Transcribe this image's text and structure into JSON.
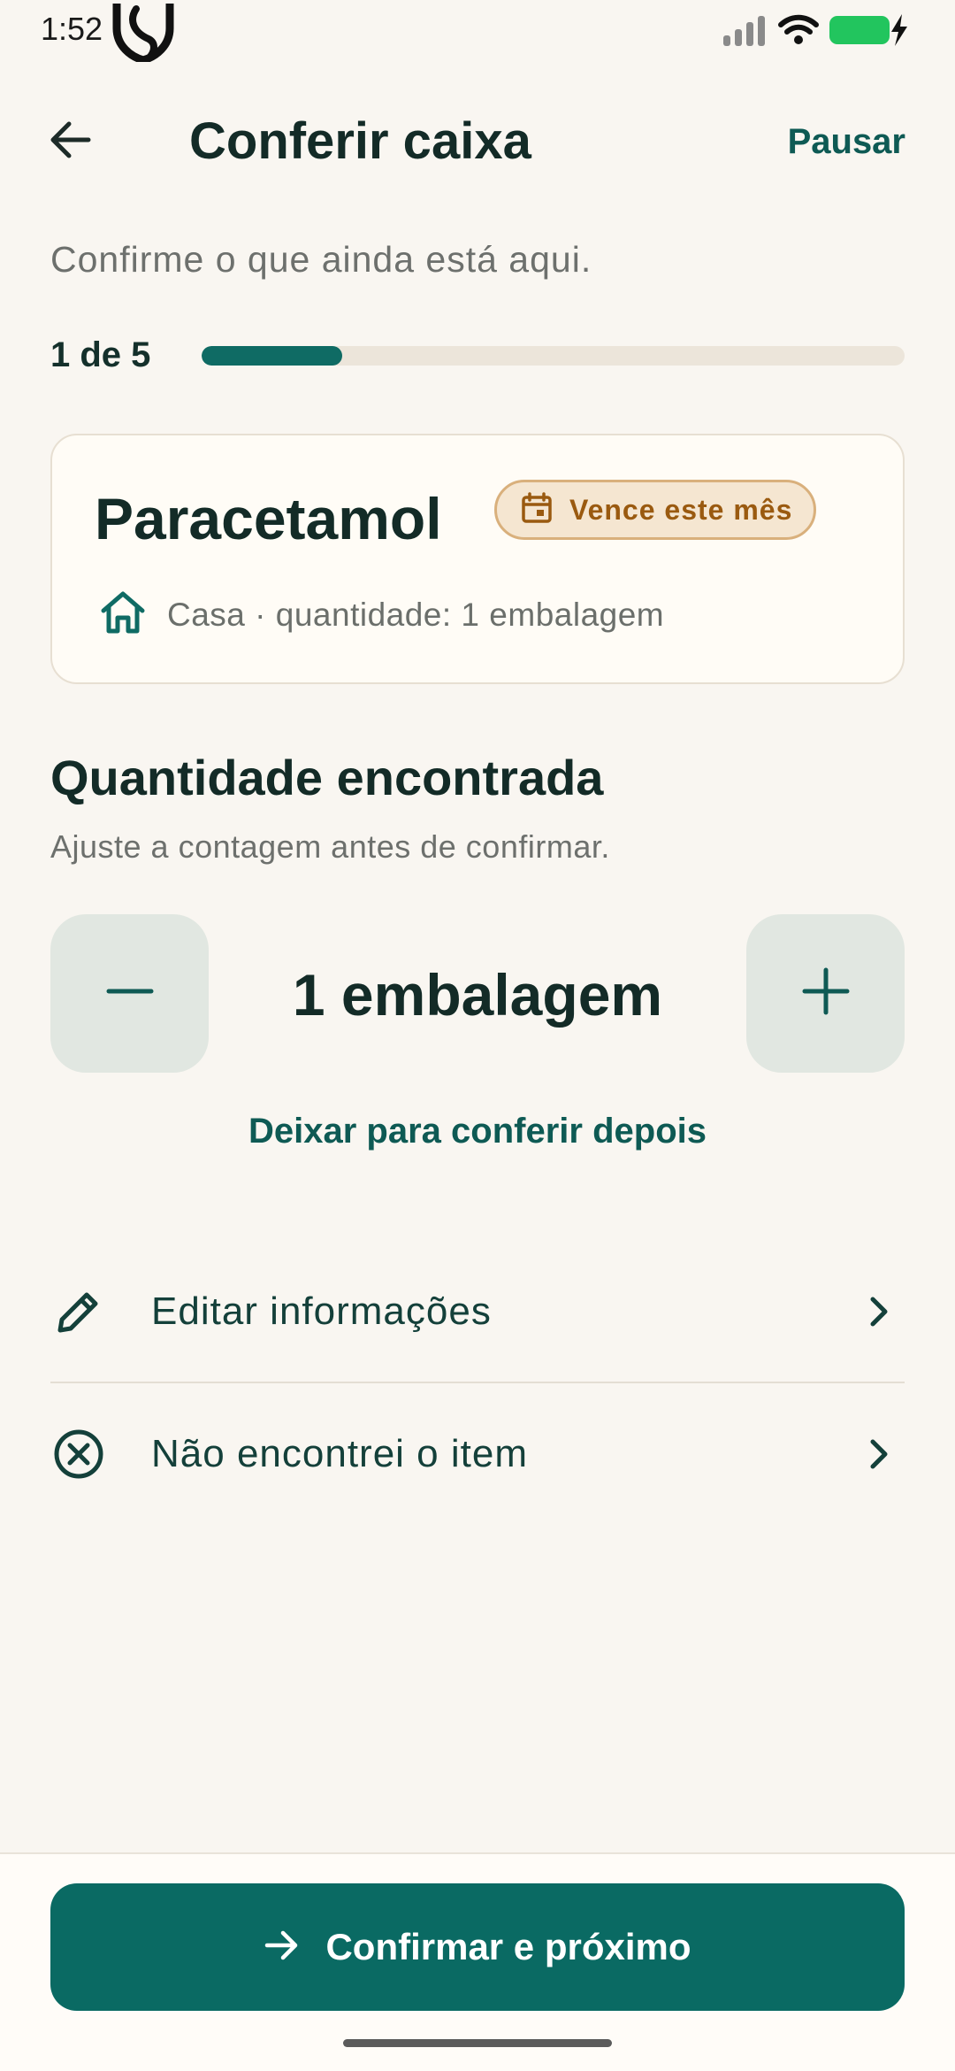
{
  "status_bar": {
    "time": "1:52",
    "icons": [
      "shield-logo-icon",
      "signal-icon",
      "wifi-icon",
      "battery-charging-icon"
    ],
    "battery_color": "#22c55e"
  },
  "header": {
    "back_icon": "arrow-left-icon",
    "title": "Conferir caixa",
    "pause_label": "Pausar"
  },
  "subtitle": "Confirme o que ainda está aqui.",
  "progress": {
    "label": "1 de 5",
    "current": 1,
    "total": 5,
    "fraction": 0.2,
    "fill_color": "#0f6b64"
  },
  "item": {
    "name": "Paracetamol",
    "badge_icon": "calendar-icon",
    "badge_label": "Vence este mês",
    "location_icon": "home-icon",
    "meta": "Casa · quantidade: 1 embalagem"
  },
  "quantity": {
    "title": "Quantidade encontrada",
    "hint": "Ajuste a contagem antes de confirmar.",
    "decrement_icon": "minus-icon",
    "increment_icon": "plus-icon",
    "value_label": "1 embalagem"
  },
  "later_link": "Deixar para conferir depois",
  "actions": [
    {
      "icon": "pencil-icon",
      "label": "Editar informações"
    },
    {
      "icon": "circle-x-icon",
      "label": "Não encontrei o item"
    }
  ],
  "footer": {
    "confirm_icon": "arrow-right-icon",
    "confirm_label": "Confirmar e próximo",
    "accent": "#0a6a63"
  }
}
